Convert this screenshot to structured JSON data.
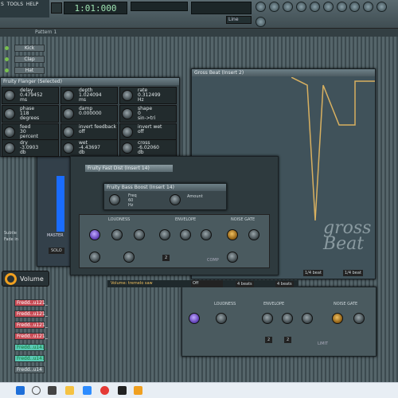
{
  "menu": {
    "items": [
      "S",
      "TOOLS",
      "HELP"
    ]
  },
  "transport": {
    "time": "1:01:000"
  },
  "preset": {
    "label": "Line"
  },
  "pattern": {
    "label": "Pattern 1"
  },
  "channels": {
    "items": [
      {
        "label": "Kick"
      },
      {
        "label": "Clap"
      },
      {
        "label": "Hat"
      }
    ],
    "fredd_items": [
      {
        "label": "Fredd..u121_"
      },
      {
        "label": "Fredd..u121_"
      },
      {
        "label": "Fredd..u121_"
      },
      {
        "label": "Fredd..u121_"
      },
      {
        "label": "Fredd..u121_"
      },
      {
        "label": "Fredd..u141_"
      },
      {
        "label": "Fredd..u141_"
      },
      {
        "label": "Fredd..u14"
      }
    ]
  },
  "flanger": {
    "title": "Fruity Flanger (Selected)",
    "params": [
      {
        "name": "delay",
        "value": "0.479452",
        "unit": "ms"
      },
      {
        "name": "depth",
        "value": "1.024094",
        "unit": "ms"
      },
      {
        "name": "rate",
        "value": "0.312499",
        "unit": "Hz"
      },
      {
        "name": "phase",
        "value": "118",
        "unit": "degrees"
      },
      {
        "name": "damp",
        "value": "0.000000",
        "unit": ""
      },
      {
        "name": "shape",
        "value": "0",
        "unit": "sin->tri"
      },
      {
        "name": "feed",
        "value": "30",
        "unit": "percent"
      },
      {
        "name": "invert feedback",
        "value": "off",
        "unit": ""
      },
      {
        "name": "invert wet",
        "value": "off",
        "unit": ""
      },
      {
        "name": "dry",
        "value": "-3.0903",
        "unit": "db"
      },
      {
        "name": "wet",
        "value": "-4.43697",
        "unit": "db"
      },
      {
        "name": "cross",
        "value": "-6.02060",
        "unit": "db"
      }
    ]
  },
  "fastdist": {
    "title": "Fruity Fast Dist (Insert 14)"
  },
  "bassboost": {
    "title": "Fruity Bass Boost (Insert 14)",
    "freq_label": "Freq",
    "freq_value": "60",
    "freq_unit": "Hz",
    "amount_label": "Amount"
  },
  "gross": {
    "title": "Gross Beat (Insert 2)",
    "brand": "gross Beat",
    "length_left": "1/4 beat",
    "length_right": "1/4 beat"
  },
  "sections": {
    "loudness": "LOUDNESS",
    "envelope": "ENVELOPE",
    "noise_gate": "NOISE GATE"
  },
  "comp": {
    "limit": "LIMIT",
    "comp": "COMP",
    "btn1": "2",
    "btn2": "2"
  },
  "mixer": {
    "master": "MASTER",
    "solo": "SOLO",
    "subtle": "Subtle",
    "fade_in": "Fade in"
  },
  "volume": {
    "label": "Volume",
    "status": "Volume: tremelo saw",
    "mode": "Off",
    "beats1": "4 beats",
    "beats2": "4 beats"
  },
  "colors": {
    "accent": "#f0a020",
    "channel_red": "#c84c56",
    "channel_teal": "#5ac8b4"
  }
}
